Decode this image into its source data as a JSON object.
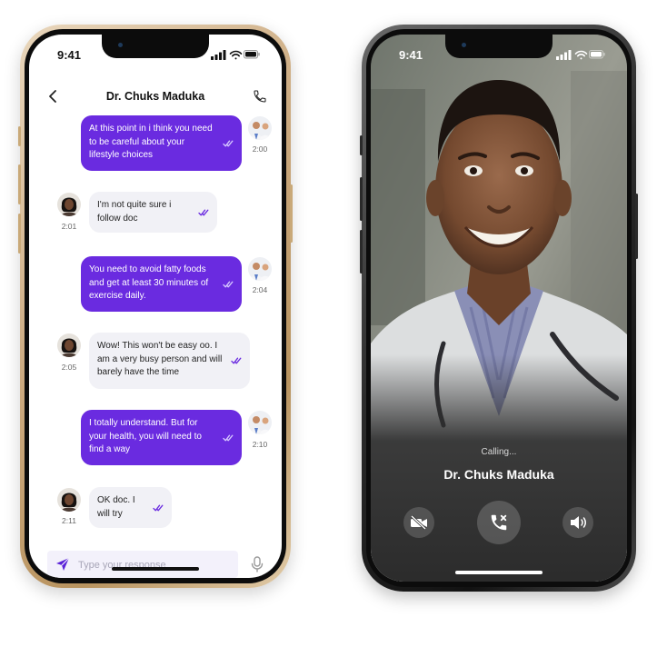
{
  "status_bar": {
    "time": "9:41"
  },
  "chat": {
    "title": "Dr. Chuks Maduka",
    "messages": [
      {
        "direction": "outgoing",
        "text": "At this point in i think you need to be careful about your lifestyle choices",
        "time": "2:00"
      },
      {
        "direction": "incoming",
        "text": "I'm not quite sure i follow doc",
        "time": "2:01"
      },
      {
        "direction": "outgoing",
        "text": "You need to avoid fatty foods and get at least 30 minutes of exercise daily.",
        "time": "2:04"
      },
      {
        "direction": "incoming",
        "text": "Wow! This won't be easy oo. I am a very busy person and will barely have the time",
        "time": "2:05"
      },
      {
        "direction": "outgoing",
        "text": "I totally understand. But for your health, you will need to find a way",
        "time": "2:10"
      },
      {
        "direction": "incoming",
        "text": "OK doc. I will try",
        "time": "2:11"
      }
    ],
    "input_placeholder": "Type your response",
    "input_value": ""
  },
  "call": {
    "status": "Calling...",
    "caller_name": "Dr. Chuks Maduka",
    "controls": [
      "video-off-icon",
      "end-call-icon",
      "speaker-icon"
    ]
  },
  "colors": {
    "accent": "#6a2be0",
    "incoming_bubble": "#f1f1f6",
    "composer_bg": "#f3f1fb",
    "call_background": "#3a3a3a"
  }
}
